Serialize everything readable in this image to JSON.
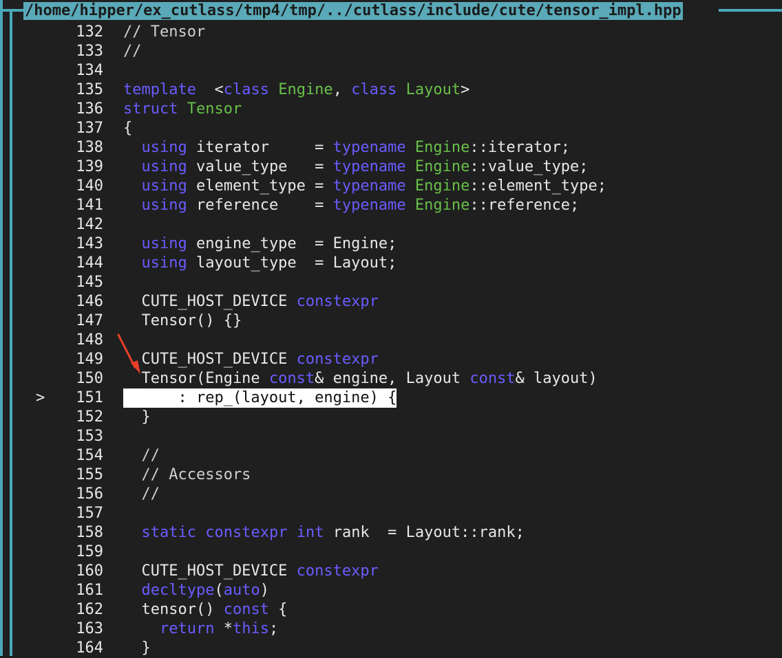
{
  "title": "/home/hipper/ex_cutlass/tmp4/tmp/../cutlass/include/cute/tensor_impl.hpp",
  "current_line_marker": ">",
  "colors": {
    "keyword": "#6a5cff",
    "type": "#68c04a",
    "border": "#4aa8b8",
    "highlight": "#ffffff"
  },
  "lines": [
    {
      "num": "132",
      "tokens": [
        [
          "cm",
          "// Tensor"
        ]
      ]
    },
    {
      "num": "133",
      "tokens": [
        [
          "cm",
          "//"
        ]
      ]
    },
    {
      "num": "134",
      "tokens": []
    },
    {
      "num": "135",
      "tokens": [
        [
          "kw",
          "template"
        ],
        [
          "",
          "  <"
        ],
        [
          "kw",
          "class"
        ],
        [
          "",
          " "
        ],
        [
          "ty",
          "Engine"
        ],
        [
          "",
          ", "
        ],
        [
          "kw",
          "class"
        ],
        [
          "",
          " "
        ],
        [
          "ty",
          "Layout"
        ],
        [
          "",
          ">"
        ]
      ]
    },
    {
      "num": "136",
      "tokens": [
        [
          "kw",
          "struct"
        ],
        [
          "",
          " "
        ],
        [
          "ty",
          "Tensor"
        ]
      ]
    },
    {
      "num": "137",
      "tokens": [
        [
          "",
          "{"
        ]
      ]
    },
    {
      "num": "138",
      "tokens": [
        [
          "",
          "  "
        ],
        [
          "kw",
          "using"
        ],
        [
          "",
          " iterator     = "
        ],
        [
          "kw",
          "typename"
        ],
        [
          "",
          " "
        ],
        [
          "ty",
          "Engine"
        ],
        [
          "",
          "::iterator;"
        ]
      ]
    },
    {
      "num": "139",
      "tokens": [
        [
          "",
          "  "
        ],
        [
          "kw",
          "using"
        ],
        [
          "",
          " value_type   = "
        ],
        [
          "kw",
          "typename"
        ],
        [
          "",
          " "
        ],
        [
          "ty",
          "Engine"
        ],
        [
          "",
          "::value_type;"
        ]
      ]
    },
    {
      "num": "140",
      "tokens": [
        [
          "",
          "  "
        ],
        [
          "kw",
          "using"
        ],
        [
          "",
          " element_type = "
        ],
        [
          "kw",
          "typename"
        ],
        [
          "",
          " "
        ],
        [
          "ty",
          "Engine"
        ],
        [
          "",
          "::element_type;"
        ]
      ]
    },
    {
      "num": "141",
      "tokens": [
        [
          "",
          "  "
        ],
        [
          "kw",
          "using"
        ],
        [
          "",
          " reference    = "
        ],
        [
          "kw",
          "typename"
        ],
        [
          "",
          " "
        ],
        [
          "ty",
          "Engine"
        ],
        [
          "",
          "::reference;"
        ]
      ]
    },
    {
      "num": "142",
      "tokens": []
    },
    {
      "num": "143",
      "tokens": [
        [
          "",
          "  "
        ],
        [
          "kw",
          "using"
        ],
        [
          "",
          " engine_type  = Engine;"
        ]
      ]
    },
    {
      "num": "144",
      "tokens": [
        [
          "",
          "  "
        ],
        [
          "kw",
          "using"
        ],
        [
          "",
          " layout_type  = Layout;"
        ]
      ]
    },
    {
      "num": "145",
      "tokens": []
    },
    {
      "num": "146",
      "tokens": [
        [
          "",
          "  CUTE_HOST_DEVICE "
        ],
        [
          "kw",
          "constexpr"
        ]
      ]
    },
    {
      "num": "147",
      "tokens": [
        [
          "",
          "  Tensor() {}"
        ]
      ]
    },
    {
      "num": "148",
      "tokens": []
    },
    {
      "num": "149",
      "tokens": [
        [
          "",
          "  CUTE_HOST_DEVICE "
        ],
        [
          "kw",
          "constexpr"
        ]
      ]
    },
    {
      "num": "150",
      "tokens": [
        [
          "",
          "  Tensor(Engine "
        ],
        [
          "kw",
          "const"
        ],
        [
          "",
          "& engine, Layout "
        ],
        [
          "kw",
          "const"
        ],
        [
          "",
          "& layout)"
        ]
      ]
    },
    {
      "num": "151",
      "current": true,
      "tokens": [
        [
          "",
          "      : rep_(layout, engine) {"
        ]
      ]
    },
    {
      "num": "152",
      "tokens": [
        [
          "",
          "  }"
        ]
      ]
    },
    {
      "num": "153",
      "tokens": []
    },
    {
      "num": "154",
      "tokens": [
        [
          "cm",
          "  //"
        ]
      ]
    },
    {
      "num": "155",
      "tokens": [
        [
          "cm",
          "  // Accessors"
        ]
      ]
    },
    {
      "num": "156",
      "tokens": [
        [
          "cm",
          "  //"
        ]
      ]
    },
    {
      "num": "157",
      "tokens": []
    },
    {
      "num": "158",
      "tokens": [
        [
          "",
          "  "
        ],
        [
          "kw",
          "static"
        ],
        [
          "",
          " "
        ],
        [
          "kw",
          "constexpr"
        ],
        [
          "",
          " "
        ],
        [
          "kw",
          "int"
        ],
        [
          "",
          " rank  = Layout::rank;"
        ]
      ]
    },
    {
      "num": "159",
      "tokens": []
    },
    {
      "num": "160",
      "tokens": [
        [
          "",
          "  CUTE_HOST_DEVICE "
        ],
        [
          "kw",
          "constexpr"
        ]
      ]
    },
    {
      "num": "161",
      "tokens": [
        [
          "",
          "  "
        ],
        [
          "kw",
          "decltype"
        ],
        [
          "",
          "("
        ],
        [
          "kw",
          "auto"
        ],
        [
          "",
          ")"
        ]
      ]
    },
    {
      "num": "162",
      "tokens": [
        [
          "",
          "  tensor() "
        ],
        [
          "kw",
          "const"
        ],
        [
          "",
          " {"
        ]
      ]
    },
    {
      "num": "163",
      "tokens": [
        [
          "",
          "    "
        ],
        [
          "kw",
          "return"
        ],
        [
          "",
          " *"
        ],
        [
          "kw",
          "this"
        ],
        [
          "",
          ";"
        ]
      ]
    },
    {
      "num": "164",
      "tokens": [
        [
          "",
          "  }"
        ]
      ]
    }
  ]
}
